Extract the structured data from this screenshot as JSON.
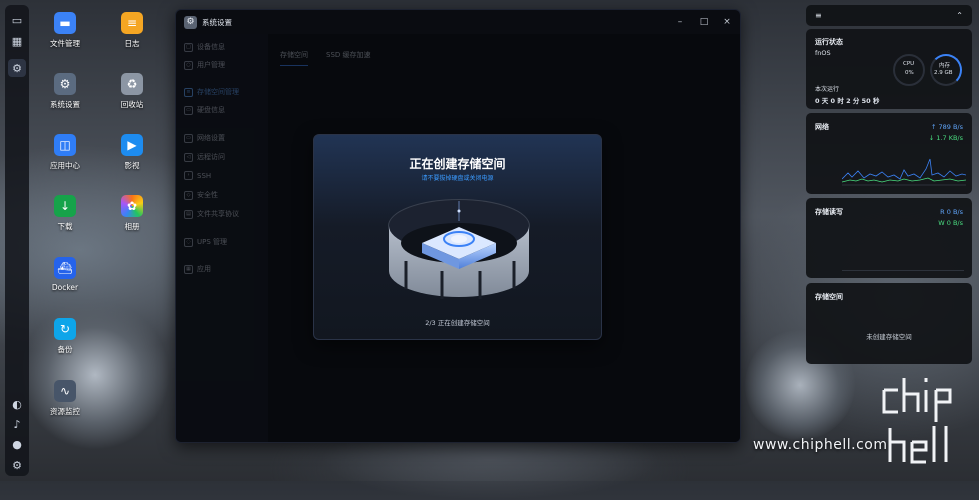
{
  "desktop": {
    "icons": [
      {
        "label": "文件管理",
        "icon": "folder-icon",
        "color": "#3b82f6"
      },
      {
        "label": "日志",
        "icon": "log-icon",
        "color": "#f5a623"
      },
      {
        "label": "系统设置",
        "icon": "gear-icon",
        "color": "#5b6b80"
      },
      {
        "label": "回收站",
        "icon": "recycle-bin-icon",
        "color": "#8c96a4"
      },
      {
        "label": "应用中心",
        "icon": "app-center-icon",
        "color": "#2f7df6"
      },
      {
        "label": "影视",
        "icon": "video-icon",
        "color": "#1d8cf0"
      },
      {
        "label": "下载",
        "icon": "download-icon",
        "color": "#16a34a"
      },
      {
        "label": "相册",
        "icon": "photos-icon",
        "color": "#f97316"
      },
      {
        "label": "Docker",
        "icon": "docker-icon",
        "color": "#2563eb"
      },
      {
        "label": "备份",
        "icon": "backup-icon",
        "color": "#0ea5e9"
      },
      {
        "label": "资源监控",
        "icon": "monitor-icon",
        "color": "#475569"
      }
    ]
  },
  "window": {
    "title": "系统设置",
    "controls": {
      "minimize": "–",
      "maximize": "□",
      "close": "×"
    },
    "nav": [
      {
        "label": "设备信息",
        "icon": "device-icon"
      },
      {
        "label": "用户管理",
        "icon": "user-icon"
      },
      {
        "label": "存储空间管理",
        "icon": "storage-icon"
      },
      {
        "label": "硬盘信息",
        "icon": "disk-icon"
      },
      {
        "label": "网络设置",
        "icon": "network-icon"
      },
      {
        "label": "远程访问",
        "icon": "remote-icon"
      },
      {
        "label": "SSH",
        "icon": "ssh-icon"
      },
      {
        "label": "安全性",
        "icon": "shield-icon"
      },
      {
        "label": "文件共享协议",
        "icon": "share-icon"
      },
      {
        "label": "UPS 管理",
        "icon": "ups-icon"
      },
      {
        "label": "应用",
        "icon": "apps-icon"
      }
    ],
    "tabs": [
      "存储空间",
      "SSD 缓存加速"
    ]
  },
  "modal": {
    "title": "正在创建存储空间",
    "subtitle": "请不要拔掉硬盘或关闭电源",
    "step": "2/3 正在创建存储空间"
  },
  "widgets": {
    "status": {
      "title": "运行状态",
      "os": "fnOS",
      "cpu_label": "CPU",
      "cpu_value": "0%",
      "mem_label": "内存",
      "mem_value": "2.9 GB",
      "uptime_label": "本次运行",
      "uptime": "0 天 0 时 2 分 50 秒"
    },
    "network": {
      "title": "网络",
      "up": "789 B/s",
      "down": "1.7 KB/s"
    },
    "storage_io": {
      "title": "存储读写",
      "read": "R 0 B/s",
      "write": "W 0 B/s"
    },
    "storage": {
      "title": "存储空间",
      "empty_text": "未创建存储空间"
    }
  },
  "watermark": "www.chiphell.com",
  "accent": "#3b82f6"
}
